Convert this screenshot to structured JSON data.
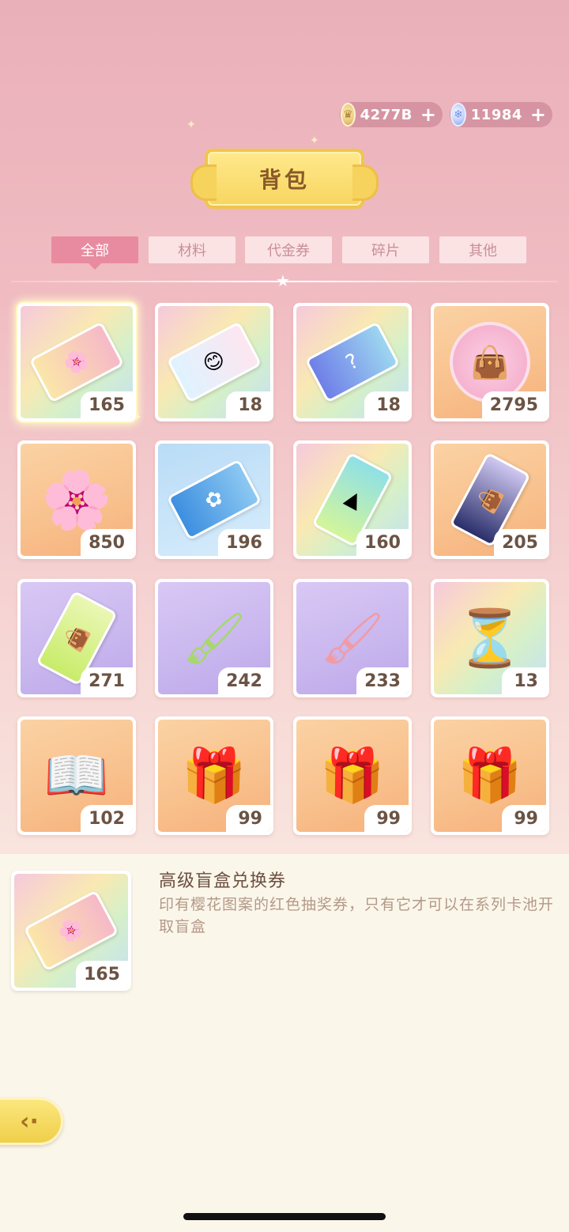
{
  "currency": {
    "coins": {
      "icon": "coin-icon",
      "value": "4277B"
    },
    "gems": {
      "icon": "gem-icon",
      "value": "11984"
    },
    "plus_symbol": "+"
  },
  "title": "背包",
  "tabs": [
    {
      "label": "全部",
      "active": true
    },
    {
      "label": "材料",
      "active": false
    },
    {
      "label": "代金券",
      "active": false
    },
    {
      "label": "碎片",
      "active": false
    },
    {
      "label": "其他",
      "active": false
    }
  ],
  "items": [
    {
      "icon": "premium-blind-box-ticket-icon",
      "count": "165",
      "selected": true
    },
    {
      "icon": "character-ticket-icon",
      "count": "18"
    },
    {
      "icon": "mystery-ticket-icon",
      "count": "18"
    },
    {
      "icon": "bag-coin-icon",
      "count": "2795"
    },
    {
      "icon": "sakura-flower-icon",
      "count": "850"
    },
    {
      "icon": "blue-ticket-icon",
      "count": "196"
    },
    {
      "icon": "video-ticket-icon",
      "count": "160"
    },
    {
      "icon": "dark-bag-ticket-icon",
      "count": "205"
    },
    {
      "icon": "green-bag-ticket-icon",
      "count": "271"
    },
    {
      "icon": "green-paint-roller-icon",
      "count": "242"
    },
    {
      "icon": "pink-paint-roller-icon",
      "count": "233"
    },
    {
      "icon": "hourglass-icon",
      "count": "13"
    },
    {
      "icon": "sketchbook-icon",
      "count": "102"
    },
    {
      "icon": "gift-box-icon",
      "count": "99"
    },
    {
      "icon": "gift-box-icon",
      "count": "99"
    },
    {
      "icon": "gift-box-icon",
      "count": "99"
    }
  ],
  "detail": {
    "name": "高级盲盒兑换券",
    "description": "印有樱花图案的红色抽奖券，只有它才可以在系列卡池开取盲盒",
    "count": "165"
  },
  "back_button": {
    "icon": "back-arrow-icon"
  }
}
